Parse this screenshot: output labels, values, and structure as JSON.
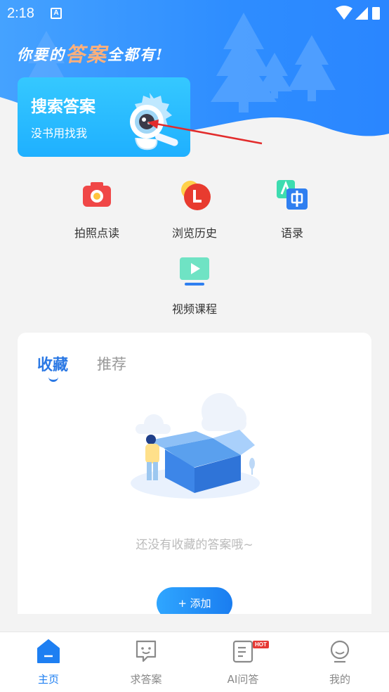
{
  "status_bar": {
    "time": "2:18",
    "badge": "A"
  },
  "hero": {
    "slogan_prefix": "你要的",
    "slogan_highlight": "答案",
    "slogan_suffix": "全都有!"
  },
  "search_card": {
    "title": "搜索答案",
    "subtitle": "没书用找我"
  },
  "shortcuts": [
    {
      "label": "拍照点读",
      "icon": "camera-icon",
      "color": "#f04747"
    },
    {
      "label": "浏览历史",
      "icon": "history-icon",
      "color": "#e83b2f"
    },
    {
      "label": "语录",
      "icon": "translate-icon",
      "color": "#2f7ff0"
    },
    {
      "label": "视频课程",
      "icon": "video-icon",
      "color": "#3ddcb0"
    }
  ],
  "collection": {
    "tab_active": "收藏",
    "tab_inactive": "推荐",
    "empty_text": "还没有收藏的答案哦~",
    "add_label": "+ 添加"
  },
  "bottom_nav": [
    {
      "label": "主页",
      "icon": "home-icon",
      "active": true
    },
    {
      "label": "求答案",
      "icon": "chat-icon",
      "active": false
    },
    {
      "label": "AI问答",
      "icon": "ai-doc-icon",
      "active": false,
      "badge": "HOT"
    },
    {
      "label": "我的",
      "icon": "profile-icon",
      "active": false
    }
  ],
  "colors": {
    "accent": "#1e7ff2",
    "hero": "#2e8dff",
    "card": "#1fb0ff"
  }
}
